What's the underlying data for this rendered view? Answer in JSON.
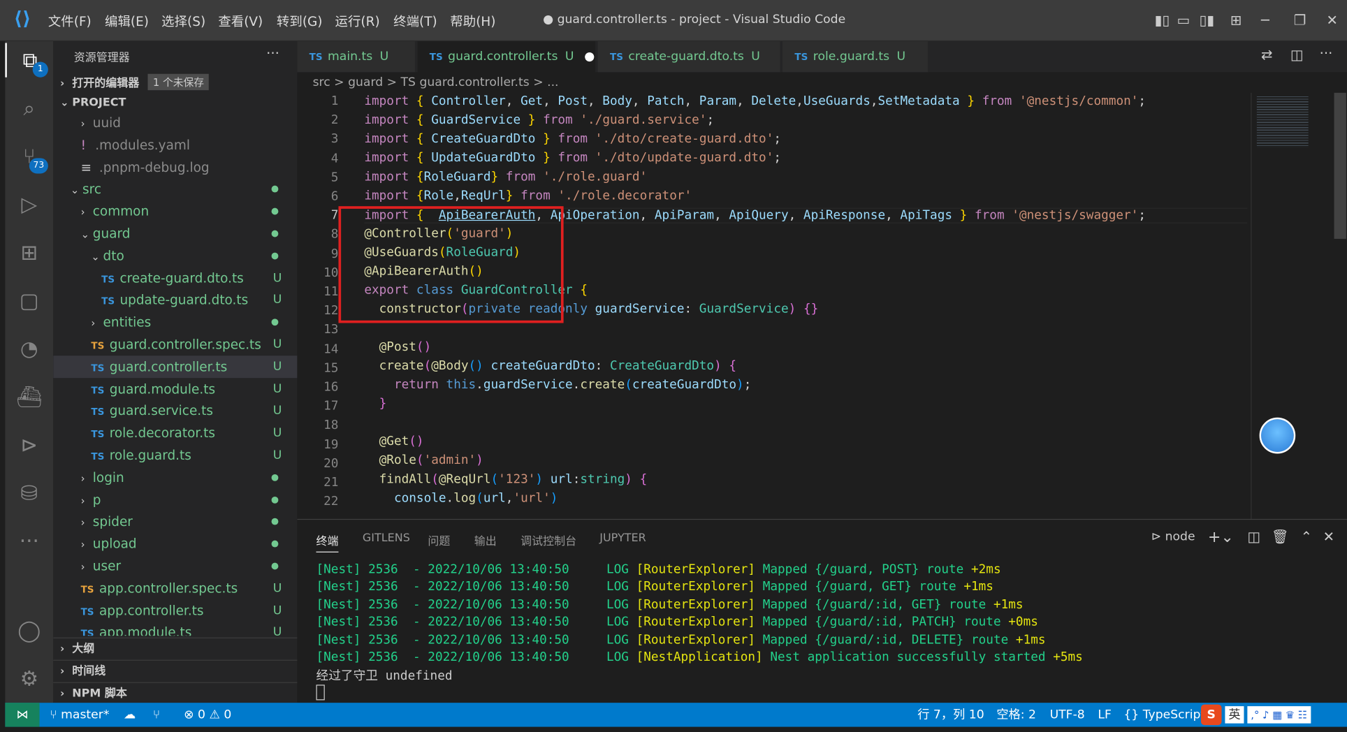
{
  "titlebar": {
    "menus": [
      "文件(F)",
      "编辑(E)",
      "选择(S)",
      "查看(V)",
      "转到(G)",
      "运行(R)",
      "终端(T)",
      "帮助(H)"
    ],
    "title": "● guard.controller.ts - project - Visual Studio Code",
    "minimize": "─",
    "restore": "❐",
    "close": "✕"
  },
  "activity": {
    "explorer_badge": "1",
    "scm_badge": "73"
  },
  "sidebar": {
    "header": "资源管理器",
    "more": "···",
    "open_editors": "打开的编辑器",
    "unsaved": "1 个未保存",
    "project": "PROJECT",
    "items": [
      {
        "label": "uuid",
        "kind": "folder-cut",
        "depth": 1
      },
      {
        "label": ".modules.yaml",
        "kind": "yaml",
        "depth": 1
      },
      {
        "label": ".pnpm-debug.log",
        "kind": "log",
        "depth": 1
      },
      {
        "label": "src",
        "kind": "folder-open",
        "depth": 0,
        "dot": true
      },
      {
        "label": "common",
        "kind": "folder",
        "depth": 1,
        "dot": true
      },
      {
        "label": "guard",
        "kind": "folder-open",
        "depth": 1,
        "dot": true
      },
      {
        "label": "dto",
        "kind": "folder-open",
        "depth": 2,
        "dot": true
      },
      {
        "label": "create-guard.dto.ts",
        "kind": "ts",
        "depth": 3,
        "u": "U"
      },
      {
        "label": "update-guard.dto.ts",
        "kind": "ts",
        "depth": 3,
        "u": "U"
      },
      {
        "label": "entities",
        "kind": "folder",
        "depth": 2,
        "dot": true
      },
      {
        "label": "guard.controller.spec.ts",
        "kind": "ts-spec",
        "depth": 2,
        "u": "U"
      },
      {
        "label": "guard.controller.ts",
        "kind": "ts",
        "depth": 2,
        "u": "U",
        "selected": true
      },
      {
        "label": "guard.module.ts",
        "kind": "ts",
        "depth": 2,
        "u": "U"
      },
      {
        "label": "guard.service.ts",
        "kind": "ts",
        "depth": 2,
        "u": "U"
      },
      {
        "label": "role.decorator.ts",
        "kind": "ts",
        "depth": 2,
        "u": "U"
      },
      {
        "label": "role.guard.ts",
        "kind": "ts",
        "depth": 2,
        "u": "U"
      },
      {
        "label": "login",
        "kind": "folder",
        "depth": 1,
        "dot": true
      },
      {
        "label": "p",
        "kind": "folder",
        "depth": 1,
        "dot": true
      },
      {
        "label": "spider",
        "kind": "folder",
        "depth": 1,
        "dot": true
      },
      {
        "label": "upload",
        "kind": "folder",
        "depth": 1,
        "dot": true
      },
      {
        "label": "user",
        "kind": "folder",
        "depth": 1,
        "dot": true
      },
      {
        "label": "app.controller.spec.ts",
        "kind": "ts-spec",
        "depth": 1,
        "u": "U"
      },
      {
        "label": "app.controller.ts",
        "kind": "ts",
        "depth": 1,
        "u": "U"
      },
      {
        "label": "app.module.ts",
        "kind": "ts",
        "depth": 1,
        "u": "U"
      }
    ],
    "outline": "大纲",
    "timeline": "时间线",
    "npm": "NPM 脚本"
  },
  "tabs": [
    {
      "ts": "TS",
      "label": "main.ts",
      "status": "U"
    },
    {
      "ts": "TS",
      "label": "guard.controller.ts",
      "status": "U",
      "dirty": "●"
    },
    {
      "ts": "TS",
      "label": "create-guard.dto.ts",
      "status": "U"
    },
    {
      "ts": "TS",
      "label": "role.guard.ts",
      "status": "U"
    }
  ],
  "breadcrumb": "src > guard > TS guard.controller.ts > ...",
  "code_lines": [
    "1",
    "2",
    "3",
    "4",
    "5",
    "6",
    "7",
    "8",
    "9",
    "10",
    "11",
    "12",
    "13",
    "14",
    "15",
    "16",
    "17",
    "18",
    "19",
    "20",
    "21",
    "22"
  ],
  "panel": {
    "tabs": [
      "终端",
      "GITLENS",
      "问题",
      "输出",
      "调试控制台",
      "JUPYTER"
    ],
    "shell": "node",
    "log_prefix": "[Nest] 2536  - 2022/10/06 13:40:50     LOG",
    "logs": [
      {
        "ctx": "[RouterExplorer]",
        "msg": "Mapped {/guard, POST} route",
        "t": "+2ms"
      },
      {
        "ctx": "[RouterExplorer]",
        "msg": "Mapped {/guard, GET} route",
        "t": "+1ms"
      },
      {
        "ctx": "[RouterExplorer]",
        "msg": "Mapped {/guard/:id, GET} route",
        "t": "+1ms"
      },
      {
        "ctx": "[RouterExplorer]",
        "msg": "Mapped {/guard/:id, PATCH} route",
        "t": "+0ms"
      },
      {
        "ctx": "[RouterExplorer]",
        "msg": "Mapped {/guard/:id, DELETE} route",
        "t": "+1ms"
      },
      {
        "ctx": "[NestApplication]",
        "msg": "Nest application successfully started",
        "t": "+5ms"
      }
    ],
    "last_line": "经过了守卫 undefined"
  },
  "status": {
    "branch": "master*",
    "errors": "0",
    "warnings": "0",
    "position": "行 7，列 10",
    "spaces": "空格: 2",
    "encoding": "UTF-8",
    "eol": "LF",
    "language": "{} TypeScript",
    "ime": "英"
  }
}
